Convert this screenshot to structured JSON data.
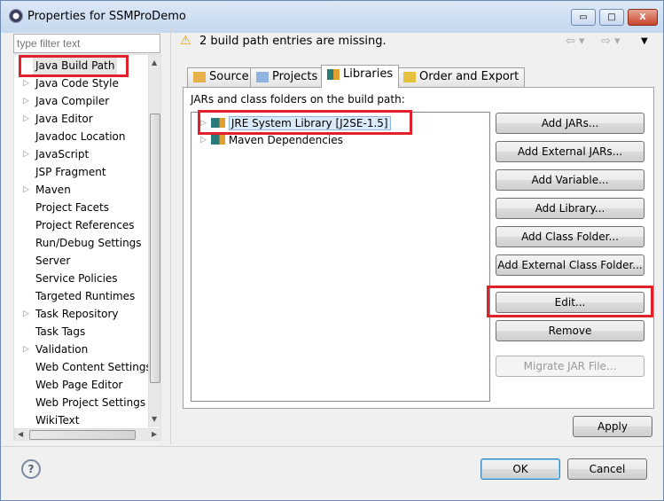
{
  "window": {
    "title": "Properties for SSMProDemo",
    "minimize": "▭",
    "maximize": "□",
    "close": "X"
  },
  "sidebar": {
    "filter_placeholder": "type filter text",
    "items": [
      {
        "label": "Java Build Path",
        "expandable": false,
        "selected": true
      },
      {
        "label": "Java Code Style",
        "expandable": true
      },
      {
        "label": "Java Compiler",
        "expandable": true
      },
      {
        "label": "Java Editor",
        "expandable": true
      },
      {
        "label": "Javadoc Location",
        "expandable": false
      },
      {
        "label": "JavaScript",
        "expandable": true
      },
      {
        "label": "JSP Fragment",
        "expandable": false
      },
      {
        "label": "Maven",
        "expandable": true
      },
      {
        "label": "Project Facets",
        "expandable": false
      },
      {
        "label": "Project References",
        "expandable": false
      },
      {
        "label": "Run/Debug Settings",
        "expandable": false
      },
      {
        "label": "Server",
        "expandable": false
      },
      {
        "label": "Service Policies",
        "expandable": false
      },
      {
        "label": "Targeted Runtimes",
        "expandable": false
      },
      {
        "label": "Task Repository",
        "expandable": true
      },
      {
        "label": "Task Tags",
        "expandable": false
      },
      {
        "label": "Validation",
        "expandable": true
      },
      {
        "label": "Web Content Settings",
        "expandable": false
      },
      {
        "label": "Web Page Editor",
        "expandable": false
      },
      {
        "label": "Web Project Settings",
        "expandable": false
      },
      {
        "label": "WikiText",
        "expandable": false
      }
    ]
  },
  "header": {
    "message": "2 build path entries are missing.",
    "icon": "warning-icon"
  },
  "tabs": [
    {
      "label": "Source"
    },
    {
      "label": "Projects"
    },
    {
      "label": "Libraries",
      "selected": true
    },
    {
      "label": "Order and Export"
    }
  ],
  "libraries": {
    "label": "JARs and class folders on the build path:",
    "entries": [
      "JRE System Library [J2SE-1.5]",
      "Maven Dependencies"
    ]
  },
  "buttons": {
    "add_jars": "Add JARs...",
    "add_external_jars": "Add External JARs...",
    "add_variable": "Add Variable...",
    "add_library": "Add Library...",
    "add_class_folder": "Add Class Folder...",
    "add_external_class_folder": "Add External Class Folder...",
    "edit": "Edit...",
    "remove": "Remove",
    "migrate": "Migrate JAR File...",
    "apply": "Apply",
    "ok": "OK",
    "cancel": "Cancel"
  },
  "colors": {
    "highlight": "#e0202a"
  }
}
